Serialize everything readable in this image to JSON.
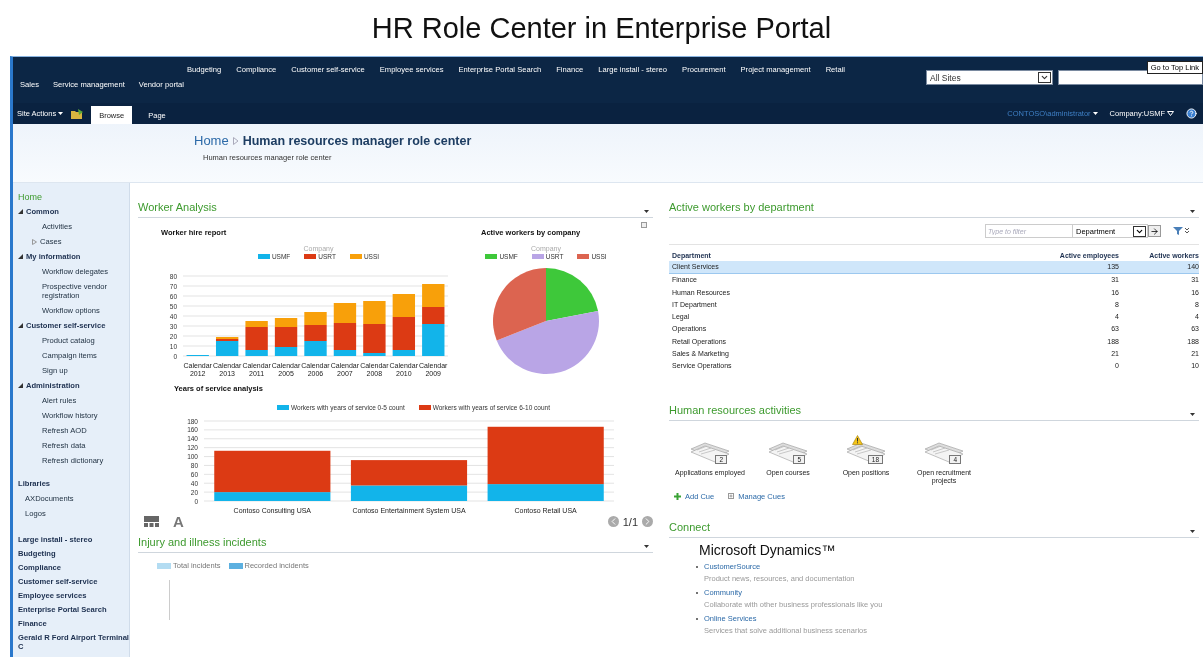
{
  "page_title": "HR Role Center in Enterprise Portal",
  "top_nav": {
    "rows": [
      {
        "links": [
          "Budgeting",
          "Compliance",
          "Customer self-service",
          "Employee services",
          "Enterprise Portal Search",
          "Finance",
          "Large install - stereo",
          "Procurement",
          "Project management",
          "Retail"
        ]
      },
      {
        "links": [
          "Sales",
          "Service management",
          "Vendor portal"
        ]
      }
    ],
    "site_select": "All Sites",
    "tooltip": "Go to Top Link"
  },
  "ribbon": {
    "site_actions": "Site Actions",
    "tabs": [
      {
        "label": "Browse",
        "selected": true
      },
      {
        "label": "Page",
        "selected": false
      }
    ],
    "user": "CONTOSO\\administrator",
    "company": "Company:USMF"
  },
  "header": {
    "home": "Home",
    "title": "Human resources manager role center",
    "subtitle": "Human resources manager role center"
  },
  "sidebar": {
    "tree": [
      {
        "label": "Home",
        "kind": "link",
        "selected": true
      },
      {
        "label": "Common",
        "kind": "group",
        "expanded": true,
        "children": [
          {
            "label": "Activities",
            "kind": "leaf"
          },
          {
            "label": "Cases",
            "kind": "branch",
            "expanded": false
          }
        ]
      },
      {
        "label": "My information",
        "kind": "group",
        "expanded": true,
        "children": [
          {
            "label": "Workflow delegates",
            "kind": "leaf"
          },
          {
            "label": "Prospective vendor registration",
            "kind": "leaf"
          },
          {
            "label": "Workflow options",
            "kind": "leaf"
          }
        ]
      },
      {
        "label": "Customer self-service",
        "kind": "group",
        "expanded": true,
        "children": [
          {
            "label": "Product catalog",
            "kind": "leaf"
          },
          {
            "label": "Campaign items",
            "kind": "leaf"
          },
          {
            "label": "Sign up",
            "kind": "leaf"
          }
        ]
      },
      {
        "label": "Administration",
        "kind": "group",
        "expanded": true,
        "children": [
          {
            "label": "Alert rules",
            "kind": "leaf"
          },
          {
            "label": "Workflow history",
            "kind": "leaf"
          },
          {
            "label": "Refresh AOD",
            "kind": "leaf"
          },
          {
            "label": "Refresh data",
            "kind": "leaf"
          },
          {
            "label": "Refresh dictionary",
            "kind": "leaf"
          }
        ]
      }
    ],
    "libraries": {
      "label": "Libraries",
      "children": [
        "AXDocuments",
        "Logos"
      ]
    },
    "quick_links": [
      "Large install - stereo",
      "Budgeting",
      "Compliance",
      "Customer self-service",
      "Employee services",
      "Enterprise Portal Search",
      "Finance",
      "Gerald R Ford Airport Terminal C"
    ]
  },
  "worker_analysis": {
    "title": "Worker Analysis",
    "hire_report": {
      "title": "Worker hire report",
      "legend_title": "Company",
      "chart_data": {
        "type": "bar",
        "stacked": true,
        "grid": true,
        "legend": true,
        "categories": [
          "Calendar 2012",
          "Calendar 2013",
          "Calendar 2011",
          "Calendar 2005",
          "Calendar 2006",
          "Calendar 2007",
          "Calendar 2008",
          "Calendar 2010",
          "Calendar 2009"
        ],
        "ylim": [
          0,
          80
        ],
        "yticks": [
          0,
          10,
          20,
          30,
          40,
          50,
          60,
          70,
          80
        ],
        "series": [
          {
            "name": "USMF",
            "color": "#12b4ea",
            "values": [
              1,
              15,
              6,
              9,
              15,
              6,
              3,
              6,
              32
            ]
          },
          {
            "name": "USRT",
            "color": "#dc3a14",
            "values": [
              0,
              2,
              23,
              20,
              16,
              27,
              29,
              33,
              17
            ]
          },
          {
            "name": "USSI",
            "color": "#f8a00a",
            "values": [
              0,
              2,
              6,
              9,
              13,
              20,
              23,
              23,
              23
            ]
          }
        ]
      }
    },
    "company_pie": {
      "title": "Active workers by company",
      "legend_title": "Company",
      "legend": [
        {
          "label": "USMF",
          "color": "#3ec83a"
        },
        {
          "label": "USRT",
          "color": "#b9a5e6"
        },
        {
          "label": "USSI",
          "color": "#dc6450"
        }
      ]
    },
    "service_chart": {
      "title": "Years of service analysis",
      "chart_data": {
        "type": "bar",
        "stacked": true,
        "grid": true,
        "legend": true,
        "categories": [
          "Contoso Consulting USA",
          "Contoso Entertainment System USA",
          "Contoso Retail USA"
        ],
        "ylim": [
          0,
          180
        ],
        "yticks": [
          0,
          20,
          40,
          60,
          80,
          100,
          120,
          140,
          160,
          180
        ],
        "series": [
          {
            "name": "Workers with years of service 0-5 count",
            "color": "#12b4ea",
            "values": [
              20,
              35,
              38
            ]
          },
          {
            "name": "Workers with years of service 6-10 count",
            "color": "#dc3a14",
            "values": [
              93,
              57,
              129
            ]
          }
        ]
      }
    },
    "text_size_button": "A",
    "pager": "1/1"
  },
  "injury": {
    "title": "Injury and illness incidents",
    "legend": [
      {
        "label": "Total incidents",
        "color": "#b3dcf2"
      },
      {
        "label": "Recorded incidents",
        "color": "#5cb0e0"
      }
    ]
  },
  "departments": {
    "title": "Active workers by department",
    "filter_placeholder": "Type to filter",
    "filter_field": "Department",
    "columns": [
      "Department",
      "Active employees",
      "Active workers"
    ],
    "rows": [
      {
        "cells": [
          "Client Services",
          "135",
          "140"
        ],
        "selected": true
      },
      {
        "cells": [
          "Finance",
          "31",
          "31"
        ],
        "selected": false
      },
      {
        "cells": [
          "Human Resources",
          "16",
          "16"
        ],
        "selected": false
      },
      {
        "cells": [
          "IT Department",
          "8",
          "8"
        ],
        "selected": false
      },
      {
        "cells": [
          "Legal",
          "4",
          "4"
        ],
        "selected": false
      },
      {
        "cells": [
          "Operations",
          "63",
          "63"
        ],
        "selected": false
      },
      {
        "cells": [
          "Retail Operations",
          "188",
          "188"
        ],
        "selected": false
      },
      {
        "cells": [
          "Sales & Marketing",
          "21",
          "21"
        ],
        "selected": false
      },
      {
        "cells": [
          "Service Operations",
          "0",
          "10"
        ],
        "selected": false
      }
    ]
  },
  "hr_activities": {
    "title": "Human resources activities",
    "cues": [
      {
        "label": "Applications employed",
        "count": "2",
        "warning": false
      },
      {
        "label": "Open courses",
        "count": "5",
        "warning": false
      },
      {
        "label": "Open positions",
        "count": "18",
        "warning": true
      },
      {
        "label": "Open recruitment projects",
        "count": "4",
        "warning": false
      }
    ],
    "actions": [
      {
        "label": "Add Cue",
        "kind": "add"
      },
      {
        "label": "Manage Cues",
        "kind": "manage"
      }
    ]
  },
  "connect": {
    "title": "Connect",
    "heading": "Microsoft Dynamics™",
    "links": [
      {
        "label": "CustomerSource",
        "description": "Product news, resources, and documentation"
      },
      {
        "label": "Community",
        "description": "Collaborate with other business professionals like you"
      },
      {
        "label": "Online Services",
        "description": "Services that solve additional business scenarios"
      }
    ]
  }
}
